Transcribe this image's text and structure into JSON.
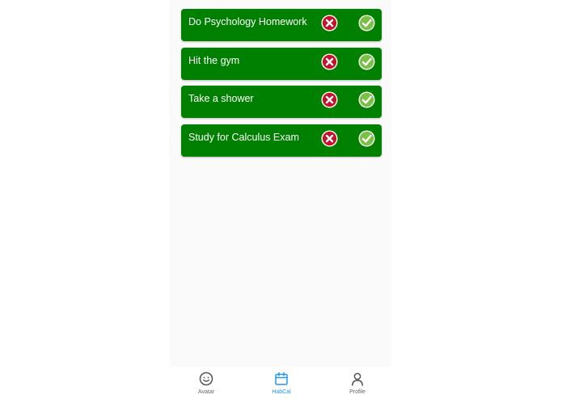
{
  "tasks": [
    {
      "label": "Do Psychology Homework"
    },
    {
      "label": "Hit the gym"
    },
    {
      "label": "Take a shower"
    },
    {
      "label": "Study for Calculus Exam"
    }
  ],
  "task_actions": {
    "reject_icon": "x-circle-icon",
    "complete_icon": "check-circle-icon"
  },
  "tabbar": {
    "tabs": [
      {
        "label": "Avatar",
        "icon": "smiley-icon",
        "active": false
      },
      {
        "label": "HabCal",
        "icon": "calendar-icon",
        "active": true
      },
      {
        "label": "Profile",
        "icon": "user-icon",
        "active": false
      }
    ]
  },
  "colors": {
    "task_bg": "#008000",
    "reject": "#c8102e",
    "complete": "#7ac143",
    "active_tab": "#2196f3",
    "inactive_tab": "#666666"
  }
}
